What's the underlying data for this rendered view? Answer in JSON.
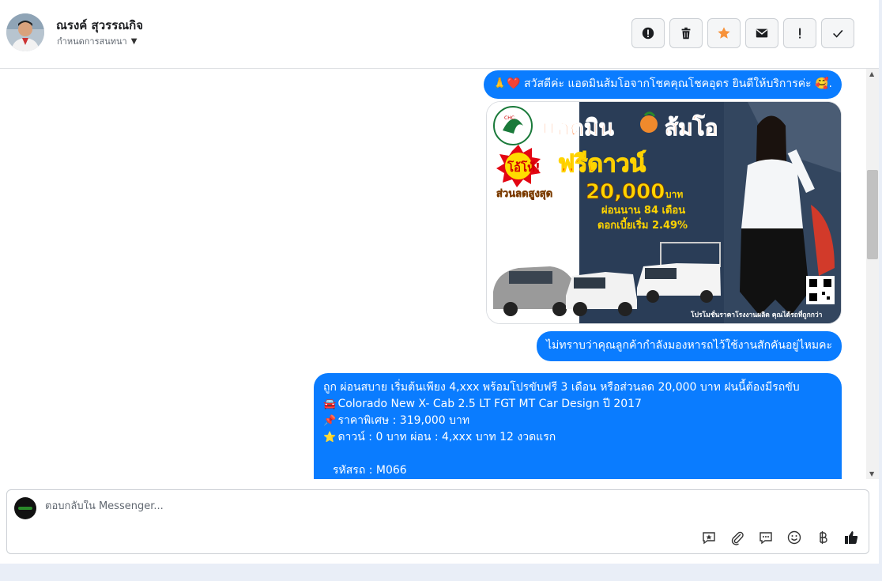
{
  "header": {
    "contact_name": "ณรงค์ สุวรรณกิจ",
    "assign_label": "กำหนดการสนทนา",
    "actions": [
      "spam-alert",
      "delete",
      "star",
      "mark-unread",
      "important",
      "done"
    ]
  },
  "messages": {
    "greeting": {
      "emoji_prefix": "🙏❤️",
      "text": "สวัสดีค่ะ แอดมินส้มโอจากโชคคุณโชคอุดร ยินดีให้บริการค่ะ",
      "emoji_suffix": "🥰."
    },
    "promo_image": {
      "badge": "โอ้โห้!",
      "headline_1": "แอดมิน",
      "headline_2": "ส้มโอ",
      "free_down": "ฟรีดาวน์",
      "discount_label": "ส่วนลดสูงสุด",
      "discount_amount": "20,000",
      "discount_unit": "บาท",
      "installment": "ผ่อนนาน 84 เดือน",
      "interest": "ดอกเบี้ยเริ่ม 2.49%",
      "footer": "โปรโมชั่นราคาโรงงานผลิต คุณได้รถที่ถูกกว่า"
    },
    "question": "ไม่ทราบว่าคุณลูกค้ากำลังมองหารถไว้ใช้งานสักคันอยู่ไหมคะ",
    "offer": {
      "line1": "ถูก ผ่อนสบาย เริ่มต้นเพียง 4,xxx พร้อมโปรขับฟรี 3 เดือน หรือส่วนลด 20,000 บาท ฝนนี้ต้องมีรถขับ",
      "line2": "Colorado New X- Cab 2.5 LT FGT MT Car Design ปี 2017",
      "line3": "ราคาพิเศษ : 319,000 บาท",
      "line4": "ดาวน์ : 0 บาท ผ่อน : 4,xxx บาท 12 งวดแรก",
      "line5": "รหัสรถ : M066",
      "icon2": "🚘",
      "icon3": "📌",
      "icon4": "⭐"
    }
  },
  "reply": {
    "placeholder": "ตอบกลับใน Messenger..."
  },
  "colors": {
    "bubble": "#0a7cff",
    "star": "#f7923a"
  }
}
